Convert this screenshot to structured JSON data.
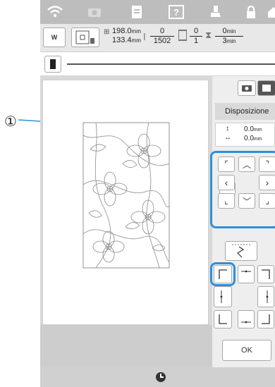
{
  "callout": {
    "number": "①"
  },
  "info": {
    "width_value": "198.0",
    "height_value": "133.4",
    "unit_mm": "mm",
    "stitch_numerator": "0",
    "stitch_denominator": "1502",
    "color_numerator": "0",
    "color_denominator": "1",
    "time_numerator": "0",
    "time_denominator": "3",
    "time_unit": "min",
    "w_label": "W"
  },
  "panel": {
    "title": "Disposizione",
    "offset_v": "0.0",
    "offset_h": "0.0",
    "unit_mm": "mm",
    "ok_label": "OK"
  },
  "colors": {
    "accent": "#2f8fd8",
    "topbar": "#bdbdbd"
  }
}
